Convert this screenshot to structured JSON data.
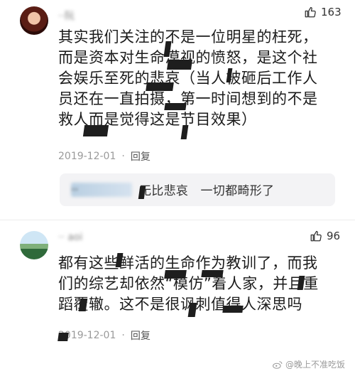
{
  "comments": [
    {
      "username": "··阮",
      "likes": "163",
      "body": "其实我们关注的不是一位明星的枉死，而是资本对生命漠视的愤怒，是这个社会娱乐至死的悲哀（当人被砸后工作人员还在一直拍摄，第一时间想到的不是救人而是觉得这是节目效果）",
      "date": "2019-12-01",
      "reply_label": "回复",
      "reply": {
        "username": "··",
        "text": "无比悲哀　一切都畸形了"
      }
    },
    {
      "username": "·· aoi",
      "likes": "96",
      "body": "都有这些鲜活的生命作为教训了，而我们的综艺却依然“模仿”着人家，并且重蹈覆辙。这不是很讽刺值得人深思吗",
      "date": "2019-12-01",
      "reply_label": "回复"
    }
  ],
  "watermark": "@晚上不准吃饭",
  "icons": {
    "like": "thumbs-up-icon",
    "weibo": "weibo-icon"
  }
}
